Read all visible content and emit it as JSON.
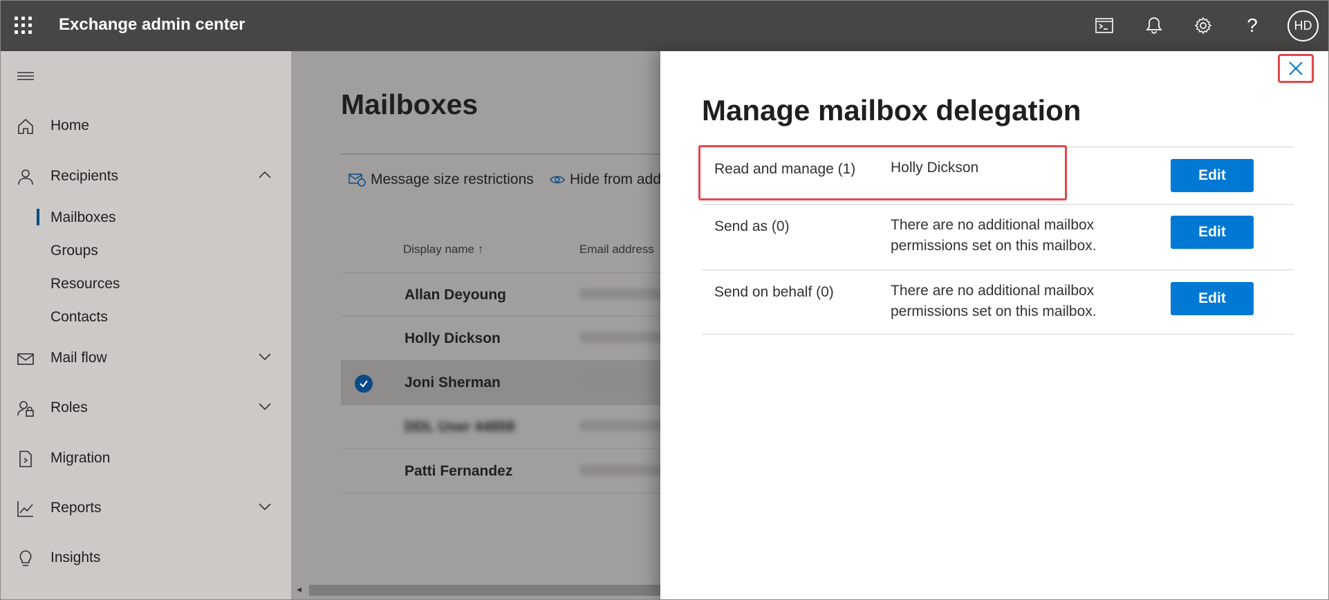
{
  "app": {
    "title": "Exchange admin center",
    "avatar_initials": "HD"
  },
  "topbar_icons": [
    "terminal-icon",
    "bell-icon",
    "gear-icon",
    "help-icon"
  ],
  "nav": {
    "home": "Home",
    "recipients": "Recipients",
    "recipients_sub": [
      "Mailboxes",
      "Groups",
      "Resources",
      "Contacts"
    ],
    "mail_flow": "Mail flow",
    "roles": "Roles",
    "migration": "Migration",
    "reports": "Reports",
    "insights": "Insights"
  },
  "main": {
    "title": "Mailboxes",
    "commands": [
      "Message size restrictions",
      "Hide from add"
    ],
    "columns": [
      "Display name ↑",
      "Email address"
    ],
    "rows": [
      {
        "name": "Allan Deyoung",
        "selected": false
      },
      {
        "name": "Holly Dickson",
        "selected": false
      },
      {
        "name": "Joni Sherman",
        "selected": true
      },
      {
        "name": "DDL User 44858",
        "selected": false
      },
      {
        "name": "Patti Fernandez",
        "selected": false
      }
    ]
  },
  "panel": {
    "title": "Manage mailbox delegation",
    "rows": [
      {
        "label": "Read and manage (1)",
        "value": "Holly Dickson",
        "button": "Edit"
      },
      {
        "label": "Send as (0)",
        "value": "There are no additional mailbox permissions set on this mailbox.",
        "button": "Edit"
      },
      {
        "label": "Send on behalf (0)",
        "value": "There are no additional mailbox permissions set on this mailbox.",
        "button": "Edit"
      }
    ]
  },
  "colors": {
    "accent": "#0078d4",
    "highlight": "#e0464c",
    "topbar": "#484644"
  }
}
